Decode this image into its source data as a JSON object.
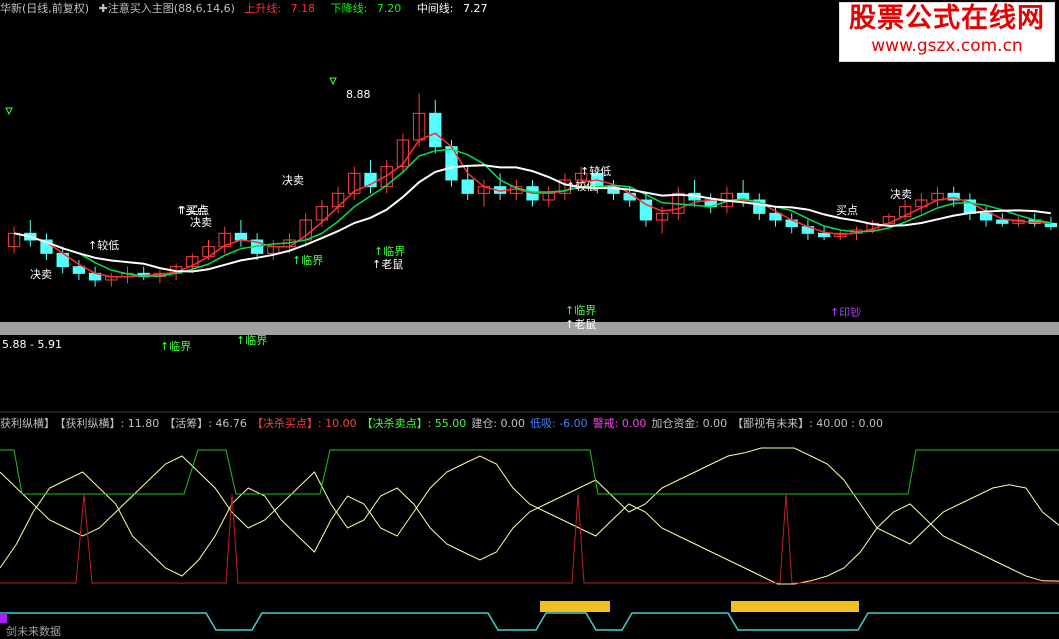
{
  "colors": {
    "background": "#000000",
    "up": "#ff4040",
    "down": "#54ffff",
    "ma_fast": "#ff3030",
    "ma_mid": "#00e050",
    "ma_slow": "#ffffff",
    "band": "#a0a0a0",
    "upper_line": "#ff3030",
    "lower_line": "#00ff00",
    "mid_line": "#ffffff",
    "indicator_green": "#22c022",
    "indicator_white": "#ffffa0",
    "indicator_red": "#c02020",
    "cyan_line": "#40d0d0",
    "yellow_bar": "#f0c020"
  },
  "header": {
    "title": "华新(日线,前复权)",
    "indicator": "✚注意买入主图(88,6,14,6)",
    "up_label": "上升线:",
    "up_value": "7.18",
    "down_label": "下降线:",
    "down_value": "7.20",
    "mid_label": "中间线:",
    "mid_value": "7.27"
  },
  "watermark": {
    "title": "股票公式在线网",
    "url": "www.gszx.com.cn"
  },
  "left_price_label": "5.88 - 5.91",
  "peak_price_label": "8.88",
  "annotations": [
    {
      "text": "决卖",
      "color": "#ffffff"
    },
    {
      "text": "↑买点",
      "color": "#ffffff"
    },
    {
      "text": "决卖",
      "color": "#ffffff"
    },
    {
      "text": "↑较低",
      "color": "#ffffff"
    },
    {
      "text": "决卖",
      "color": "#ffffff"
    },
    {
      "text": "↑临界",
      "color": "#40ff40"
    },
    {
      "text": "↑临界",
      "color": "#40ff40"
    },
    {
      "text": "↑临界",
      "color": "#40ff40"
    },
    {
      "text": "↑老鼠",
      "color": "#ffffff"
    },
    {
      "text": "↑较低",
      "color": "#ffffff"
    },
    {
      "text": "↑较低",
      "color": "#ffffff"
    },
    {
      "text": "买点",
      "color": "#ffffff"
    },
    {
      "text": "↑临界",
      "color": "#40ff40"
    },
    {
      "text": "↑老鼠",
      "color": "#ffffff"
    },
    {
      "text": "↑买点",
      "color": "#ffffff"
    },
    {
      "text": "决卖",
      "color": "#ffffff"
    },
    {
      "text": "↑印钞",
      "color": "#b040ff"
    },
    {
      "text": "↑临界",
      "color": "#40ff40"
    }
  ],
  "indicator_header": [
    {
      "text": "获利纵横】",
      "color": "#c0c0c0"
    },
    {
      "text": "【获利纵横】: 11.80",
      "color": "#c0c0c0"
    },
    {
      "text": "【活筹】: 46.76",
      "color": "#c0c0c0"
    },
    {
      "text": "【决杀买点】: 10.00",
      "color": "#ff4040"
    },
    {
      "text": "【决杀卖点】: 55.00",
      "color": "#40ff40"
    },
    {
      "text": "建仓: 0.00",
      "color": "#c0c0c0"
    },
    {
      "text": "低吸: -6.00",
      "color": "#4080ff"
    },
    {
      "text": "警戒: 0.00",
      "color": "#ff40ff"
    },
    {
      "text": "加仓资金: 0.00",
      "color": "#c0c0c0"
    },
    {
      "text": "【鄙视有未来】: 40.00 : 0.00",
      "color": "#c0c0c0"
    }
  ],
  "bottom_label": "剑未来数据",
  "chart_data": [
    {
      "type": "candlestick",
      "title": "华新(日线,前复权)",
      "note": "Price chart with moving-average lines; prices estimated.",
      "ylim": [
        5.5,
        9.1
      ],
      "candles": [
        [
          6.6,
          6.9,
          6.5,
          6.8
        ],
        [
          6.8,
          7.0,
          6.6,
          6.7
        ],
        [
          6.7,
          6.8,
          6.4,
          6.5
        ],
        [
          6.5,
          6.6,
          6.2,
          6.3
        ],
        [
          6.3,
          6.4,
          6.1,
          6.2
        ],
        [
          6.2,
          6.3,
          6.0,
          6.1
        ],
        [
          6.1,
          6.2,
          6.0,
          6.15
        ],
        [
          6.15,
          6.3,
          6.05,
          6.2
        ],
        [
          6.2,
          6.3,
          6.1,
          6.15
        ],
        [
          6.15,
          6.25,
          6.05,
          6.2
        ],
        [
          6.2,
          6.35,
          6.1,
          6.3
        ],
        [
          6.3,
          6.5,
          6.2,
          6.45
        ],
        [
          6.45,
          6.7,
          6.4,
          6.6
        ],
        [
          6.6,
          6.9,
          6.5,
          6.8
        ],
        [
          6.8,
          7.0,
          6.6,
          6.7
        ],
        [
          6.7,
          6.8,
          6.4,
          6.5
        ],
        [
          6.5,
          6.7,
          6.4,
          6.6
        ],
        [
          6.6,
          6.8,
          6.5,
          6.7
        ],
        [
          6.7,
          7.1,
          6.6,
          7.0
        ],
        [
          7.0,
          7.3,
          6.9,
          7.2
        ],
        [
          7.2,
          7.5,
          7.1,
          7.4
        ],
        [
          7.4,
          7.8,
          7.3,
          7.7
        ],
        [
          7.7,
          7.9,
          7.4,
          7.5
        ],
        [
          7.5,
          7.9,
          7.4,
          7.8
        ],
        [
          7.8,
          8.3,
          7.7,
          8.2
        ],
        [
          8.2,
          8.9,
          8.1,
          8.6
        ],
        [
          8.6,
          8.8,
          8.0,
          8.1
        ],
        [
          8.1,
          8.2,
          7.5,
          7.6
        ],
        [
          7.6,
          7.8,
          7.3,
          7.4
        ],
        [
          7.4,
          7.6,
          7.2,
          7.5
        ],
        [
          7.5,
          7.7,
          7.3,
          7.4
        ],
        [
          7.4,
          7.6,
          7.3,
          7.5
        ],
        [
          7.5,
          7.6,
          7.2,
          7.3
        ],
        [
          7.3,
          7.5,
          7.2,
          7.4
        ],
        [
          7.4,
          7.7,
          7.3,
          7.6
        ],
        [
          7.6,
          7.8,
          7.5,
          7.7
        ],
        [
          7.7,
          7.8,
          7.4,
          7.5
        ],
        [
          7.5,
          7.6,
          7.3,
          7.4
        ],
        [
          7.4,
          7.5,
          7.2,
          7.3
        ],
        [
          7.3,
          7.4,
          6.9,
          7.0
        ],
        [
          7.0,
          7.2,
          6.8,
          7.1
        ],
        [
          7.1,
          7.5,
          7.0,
          7.4
        ],
        [
          7.4,
          7.6,
          7.2,
          7.3
        ],
        [
          7.3,
          7.4,
          7.1,
          7.2
        ],
        [
          7.2,
          7.5,
          7.1,
          7.4
        ],
        [
          7.4,
          7.6,
          7.2,
          7.3
        ],
        [
          7.3,
          7.4,
          7.0,
          7.1
        ],
        [
          7.1,
          7.2,
          6.9,
          7.0
        ],
        [
          7.0,
          7.1,
          6.8,
          6.9
        ],
        [
          6.9,
          7.0,
          6.7,
          6.8
        ],
        [
          6.8,
          6.9,
          6.7,
          6.75
        ],
        [
          6.75,
          6.85,
          6.7,
          6.8
        ],
        [
          6.8,
          6.9,
          6.7,
          6.85
        ],
        [
          6.85,
          7.0,
          6.8,
          6.95
        ],
        [
          6.95,
          7.1,
          6.9,
          7.05
        ],
        [
          7.05,
          7.3,
          7.0,
          7.2
        ],
        [
          7.2,
          7.4,
          7.1,
          7.3
        ],
        [
          7.3,
          7.5,
          7.2,
          7.4
        ],
        [
          7.4,
          7.5,
          7.2,
          7.3
        ],
        [
          7.3,
          7.4,
          7.0,
          7.1
        ],
        [
          7.1,
          7.2,
          6.9,
          7.0
        ],
        [
          7.0,
          7.1,
          6.9,
          6.95
        ],
        [
          6.95,
          7.05,
          6.9,
          7.0
        ],
        [
          7.0,
          7.1,
          6.9,
          6.95
        ],
        [
          6.95,
          7.05,
          6.85,
          6.9
        ]
      ]
    },
    {
      "type": "line",
      "title": "获利纵横",
      "ylim": [
        0,
        100
      ],
      "series": [
        {
          "name": "获利纵横",
          "values": [
            20,
            35,
            55,
            70,
            75,
            80,
            70,
            60,
            40,
            30,
            20,
            15,
            25,
            40,
            60,
            70,
            65,
            50,
            40,
            30,
            50,
            65,
            60,
            45,
            40,
            55,
            70,
            80,
            85,
            90,
            85,
            70,
            60,
            55,
            50,
            45,
            40,
            50,
            60,
            55,
            45,
            40,
            35,
            30,
            25,
            20,
            15,
            10,
            10,
            12,
            15,
            20,
            30,
            45,
            55,
            60,
            50,
            40,
            35,
            30,
            25,
            20,
            15,
            12,
            11.8
          ]
        },
        {
          "name": "活筹",
          "values": [
            80,
            70,
            60,
            50,
            45,
            40,
            45,
            55,
            65,
            75,
            85,
            90,
            80,
            70,
            55,
            45,
            50,
            60,
            70,
            80,
            60,
            45,
            50,
            65,
            70,
            60,
            45,
            35,
            30,
            25,
            30,
            45,
            55,
            60,
            65,
            70,
            75,
            65,
            55,
            60,
            70,
            75,
            80,
            85,
            90,
            92,
            95,
            95,
            95,
            90,
            85,
            75,
            60,
            45,
            40,
            35,
            45,
            55,
            60,
            65,
            70,
            72,
            70,
            55,
            46.76
          ]
        }
      ]
    }
  ]
}
